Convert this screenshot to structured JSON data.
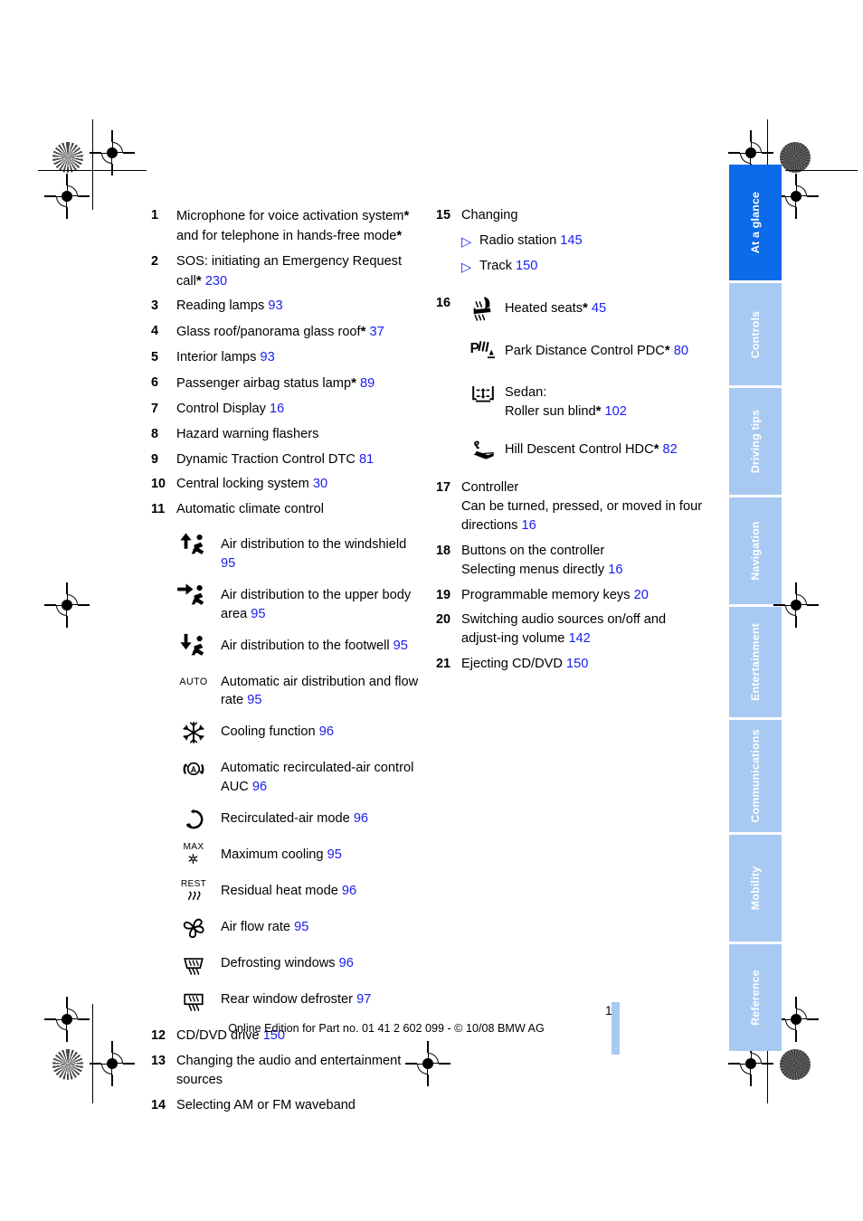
{
  "page": {
    "number": "15",
    "footer": "Online Edition for Part no. 01 41 2 602 099 - © 10/08 BMW AG",
    "accent_blue": "#0b6be8",
    "tab_blue": "#a8caf2",
    "reference_color": "#1a20f0"
  },
  "sidebar": {
    "tabs": [
      {
        "label": "At a glance",
        "active": true
      },
      {
        "label": "Controls",
        "active": false
      },
      {
        "label": "Driving tips",
        "active": false
      },
      {
        "label": "Navigation",
        "active": false
      },
      {
        "label": "Entertainment",
        "active": false
      },
      {
        "label": "Communications",
        "active": false
      },
      {
        "label": "Mobility",
        "active": false
      },
      {
        "label": "Reference",
        "active": false
      }
    ]
  },
  "left_column": {
    "items": [
      {
        "num": "1",
        "text": "Microphone for voice activation system",
        "asterisk": true,
        "line2": "and for telephone in hands-free mode",
        "line2_asterisk": true,
        "ref": ""
      },
      {
        "num": "2",
        "text": "SOS: initiating an Emergency Request",
        "line2": "call",
        "line2_asterisk": true,
        "ref": "230"
      },
      {
        "num": "3",
        "text": "Reading lamps",
        "ref": "93"
      },
      {
        "num": "4",
        "text": "Glass roof/panorama glass roof",
        "asterisk": true,
        "ref": "37"
      },
      {
        "num": "5",
        "text": "Interior lamps",
        "ref": "93"
      },
      {
        "num": "6",
        "text": "Passenger airbag status lamp",
        "asterisk": true,
        "ref": "89"
      },
      {
        "num": "7",
        "text": "Control Display",
        "ref": "16"
      },
      {
        "num": "8",
        "text": "Hazard warning flashers",
        "ref": ""
      },
      {
        "num": "9",
        "text": "Dynamic Traction Control DTC",
        "ref": "81"
      },
      {
        "num": "10",
        "text": "Central locking system",
        "ref": "30"
      },
      {
        "num": "11",
        "text": "Automatic climate control",
        "ref": ""
      }
    ],
    "climate_icons": [
      {
        "icon": "air-distribution-windshield-icon",
        "label": "Air distribution to the windshield",
        "ref": "95"
      },
      {
        "icon": "air-distribution-upper-body-icon",
        "label": "Air distribution to the upper body area",
        "ref": "95"
      },
      {
        "icon": "air-distribution-footwell-icon",
        "label": "Air distribution to the footwell",
        "ref": "95"
      },
      {
        "icon": "auto-text-icon",
        "label": "Automatic air distribution and flow rate",
        "ref": "95"
      },
      {
        "icon": "snowflake-cooling-icon",
        "label": "Cooling function",
        "ref": "96"
      },
      {
        "icon": "auc-recirculation-icon",
        "label": "Automatic recirculated-air control AUC",
        "ref": "96"
      },
      {
        "icon": "recirculated-air-icon",
        "label": "Recirculated-air mode",
        "ref": "96"
      },
      {
        "icon": "max-cooling-icon",
        "label": "Maximum cooling",
        "ref": "95"
      },
      {
        "icon": "rest-residual-heat-icon",
        "label": "Residual heat mode",
        "ref": "96"
      },
      {
        "icon": "fan-air-flow-icon",
        "label": "Air flow rate",
        "ref": "95"
      },
      {
        "icon": "defrost-windshield-icon",
        "label": "Defrosting windows",
        "ref": "96"
      },
      {
        "icon": "rear-window-defroster-icon",
        "label": "Rear window defroster",
        "ref": "97"
      }
    ],
    "items_after": [
      {
        "num": "12",
        "text": "CD/DVD drive",
        "ref": "150"
      },
      {
        "num": "13",
        "text": "Changing the audio and entertainment",
        "line2": "sources",
        "ref": ""
      },
      {
        "num": "14",
        "text": "Selecting AM or FM waveband",
        "ref": ""
      }
    ]
  },
  "right_column": {
    "item15": {
      "num": "15",
      "text": "Changing",
      "subitems": [
        {
          "label": "Radio station",
          "ref": "145"
        },
        {
          "label": "Track",
          "ref": "150"
        }
      ]
    },
    "item16": {
      "num": "16",
      "icons": [
        {
          "icon": "heated-seat-icon",
          "label": "Heated seats",
          "asterisk": true,
          "ref": "45"
        },
        {
          "icon": "park-distance-control-icon",
          "label": "Park Distance Control PDC",
          "asterisk": true,
          "ref": "80"
        },
        {
          "icon": "roller-sun-blind-icon",
          "label": "Sedan:",
          "label2": "Roller sun blind",
          "asterisk": true,
          "ref": "102"
        },
        {
          "icon": "hill-descent-control-icon",
          "label": "Hill Descent Control HDC",
          "asterisk": true,
          "ref": "82"
        }
      ]
    },
    "items": [
      {
        "num": "17",
        "text": "Controller",
        "ref": "16",
        "line2": "Can be turned, pressed, or moved in four directions"
      },
      {
        "num": "18",
        "text": "Buttons on the controller",
        "ref": "16",
        "line2": "Selecting menus directly"
      },
      {
        "num": "19",
        "text": "Programmable memory keys",
        "ref": "20"
      },
      {
        "num": "20",
        "text": "Switching audio sources on/off and adjust-ing volume",
        "ref": "142"
      },
      {
        "num": "21",
        "text": "Ejecting CD/DVD",
        "ref": "150"
      }
    ]
  }
}
